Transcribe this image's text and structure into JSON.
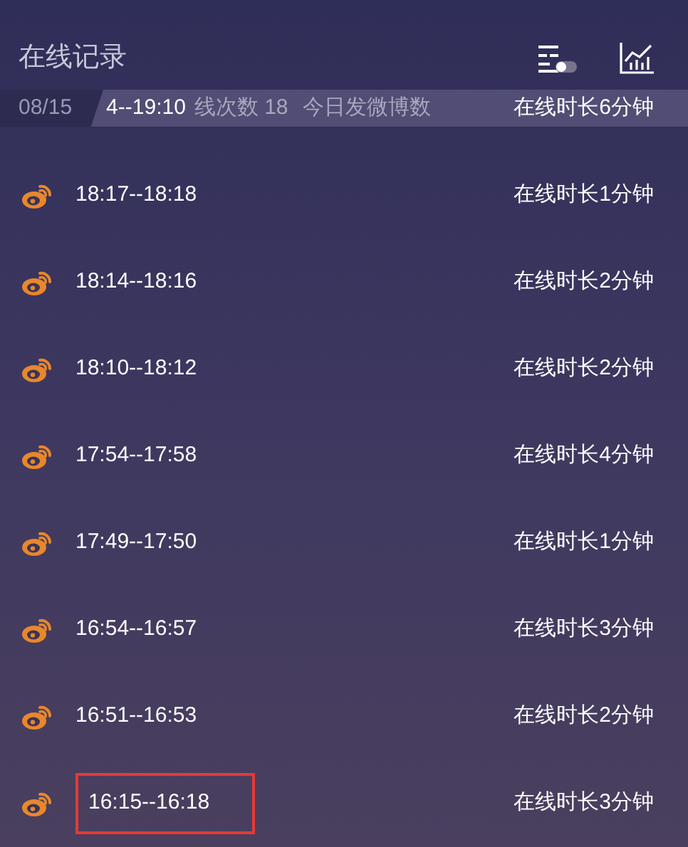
{
  "header": {
    "title": "在线记录"
  },
  "summary": {
    "date": "08/15",
    "partial_time": "4--19:10",
    "online_count": "线次数 18",
    "posts_label": "今日发微博数",
    "partial_duration": "在线时长6分钟"
  },
  "records": [
    {
      "time": "18:17--18:18",
      "duration": "在线时长1分钟",
      "highlighted": false
    },
    {
      "time": "18:14--18:16",
      "duration": "在线时长2分钟",
      "highlighted": false
    },
    {
      "time": "18:10--18:12",
      "duration": "在线时长2分钟",
      "highlighted": false
    },
    {
      "time": "17:54--17:58",
      "duration": "在线时长4分钟",
      "highlighted": false
    },
    {
      "time": "17:49--17:50",
      "duration": "在线时长1分钟",
      "highlighted": false
    },
    {
      "time": "16:54--16:57",
      "duration": "在线时长3分钟",
      "highlighted": false
    },
    {
      "time": "16:51--16:53",
      "duration": "在线时长2分钟",
      "highlighted": false
    },
    {
      "time": "16:15--16:18",
      "duration": "在线时长3分钟",
      "highlighted": true
    }
  ]
}
